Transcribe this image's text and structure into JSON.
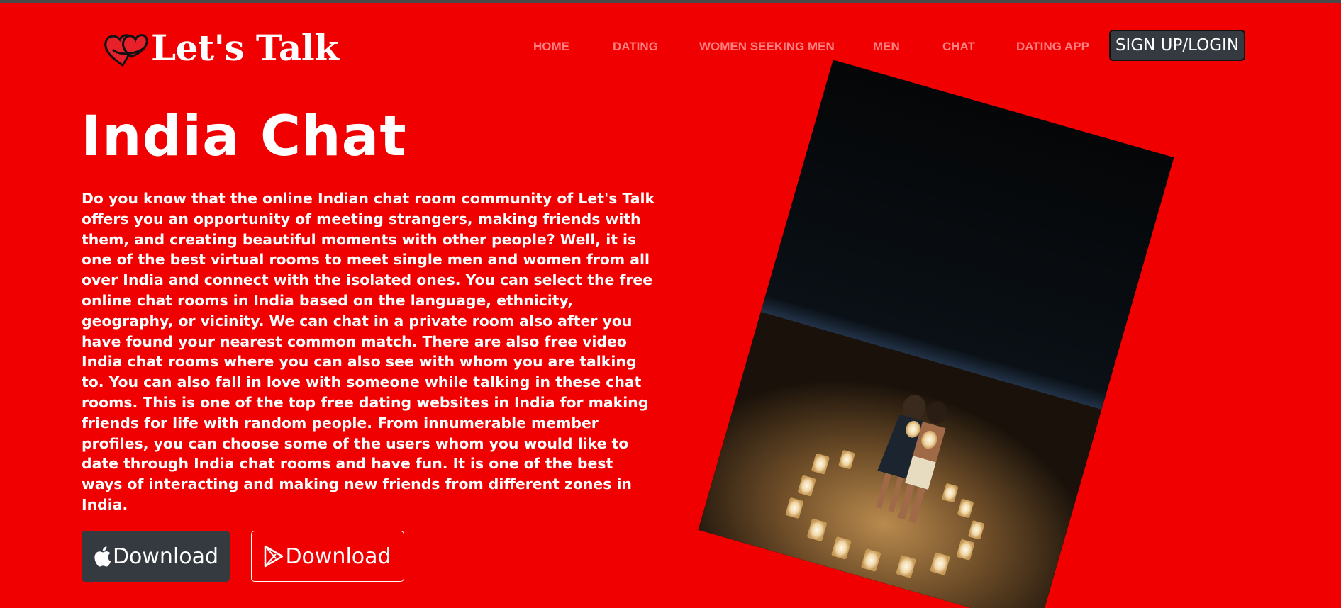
{
  "brand": {
    "name": "Let's Talk",
    "logo_icon": "hearts-icon"
  },
  "nav": {
    "items": [
      "HOME",
      "DATING",
      "WOMEN SEEKING MEN",
      "MEN",
      "CHAT",
      "DATING APP"
    ],
    "signup_label": "SIGN UP/LOGIN"
  },
  "hero": {
    "title": "India Chat",
    "description": "Do you know that the online Indian chat room community of Let's Talk offers you an opportunity of meeting strangers, making friends with them, and creating beautiful moments with other people? Well, it is one of the best virtual rooms to meet single men and women from all over India and connect with the isolated ones. You can select the free online chat rooms in India based on the language, ethnicity, geography, or vicinity. We can chat in a private room also after you have found your nearest common match. There are also free video India chat rooms where you can also see with whom you are talking to. You can also fall in love with someone while talking in these chat rooms. This is one of the top free dating websites in India for making friends for life with random people. From innumerable member profiles, you can choose some of the users whom you would like to date through India chat rooms and have fun. It is one of the best ways of interacting and making new friends from different zones in India.",
    "download_apple_label": "Download",
    "download_play_label": "Download",
    "apple_icon": "apple-icon",
    "play_icon": "google-play-icon"
  },
  "colors": {
    "background": "#f00000",
    "nav_text": "#ff8080",
    "button_dark": "#343a40",
    "text": "#ffffff"
  }
}
